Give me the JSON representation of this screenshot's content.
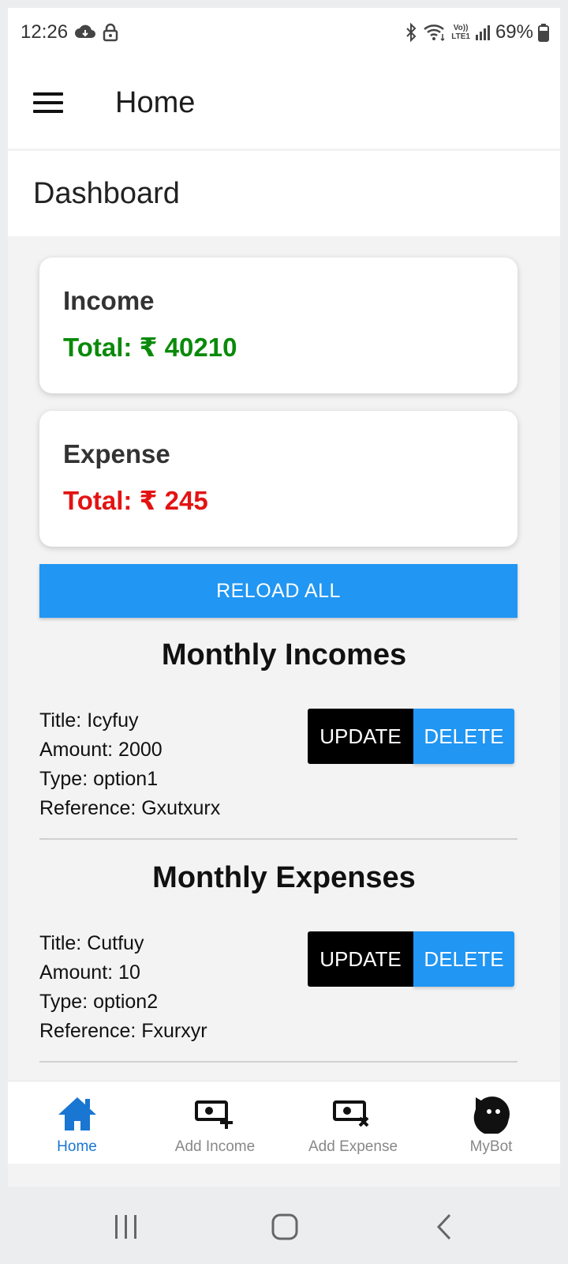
{
  "status_bar": {
    "time": "12:26",
    "battery": "69%",
    "icons": [
      "cloud-icon",
      "lock-icon",
      "bluetooth-icon",
      "wifi-icon",
      "volte-icon",
      "signal-icon",
      "battery-icon"
    ],
    "volte_line1": "Vo))",
    "volte_line2": "LTE1"
  },
  "app_bar": {
    "title": "Home"
  },
  "dashboard": {
    "title": "Dashboard"
  },
  "income_card": {
    "label": "Income",
    "total": "Total:  ₹ 40210"
  },
  "expense_card": {
    "label": "Expense",
    "total": "Total:  ₹ 245"
  },
  "reload_button": "RELOAD ALL",
  "monthly_incomes": {
    "title": "Monthly Incomes",
    "items": [
      {
        "title": "Title: Icyfuy",
        "amount": "Amount: 2000",
        "type": "Type: option1",
        "reference": "Reference: Gxutxurx",
        "update_label": "UPDATE",
        "delete_label": "DELETE"
      }
    ]
  },
  "monthly_expenses": {
    "title": "Monthly Expenses",
    "items": [
      {
        "title": "Title: Cutfuy",
        "amount": "Amount: 10",
        "type": "Type: option2",
        "reference": "Reference: Fxurxyr",
        "update_label": "UPDATE",
        "delete_label": "DELETE"
      }
    ]
  },
  "bottom_nav": {
    "items": [
      {
        "label": "Home",
        "icon": "home-icon",
        "active": true
      },
      {
        "label": "Add Income",
        "icon": "add-money-icon",
        "active": false
      },
      {
        "label": "Add Expense",
        "icon": "remove-money-icon",
        "active": false
      },
      {
        "label": "MyBot",
        "icon": "bot-icon",
        "active": false
      }
    ]
  },
  "colors": {
    "primary_blue": "#2196f3",
    "income_green": "#0a8a0a",
    "expense_red": "#e31313",
    "active_nav": "#1976d2"
  }
}
